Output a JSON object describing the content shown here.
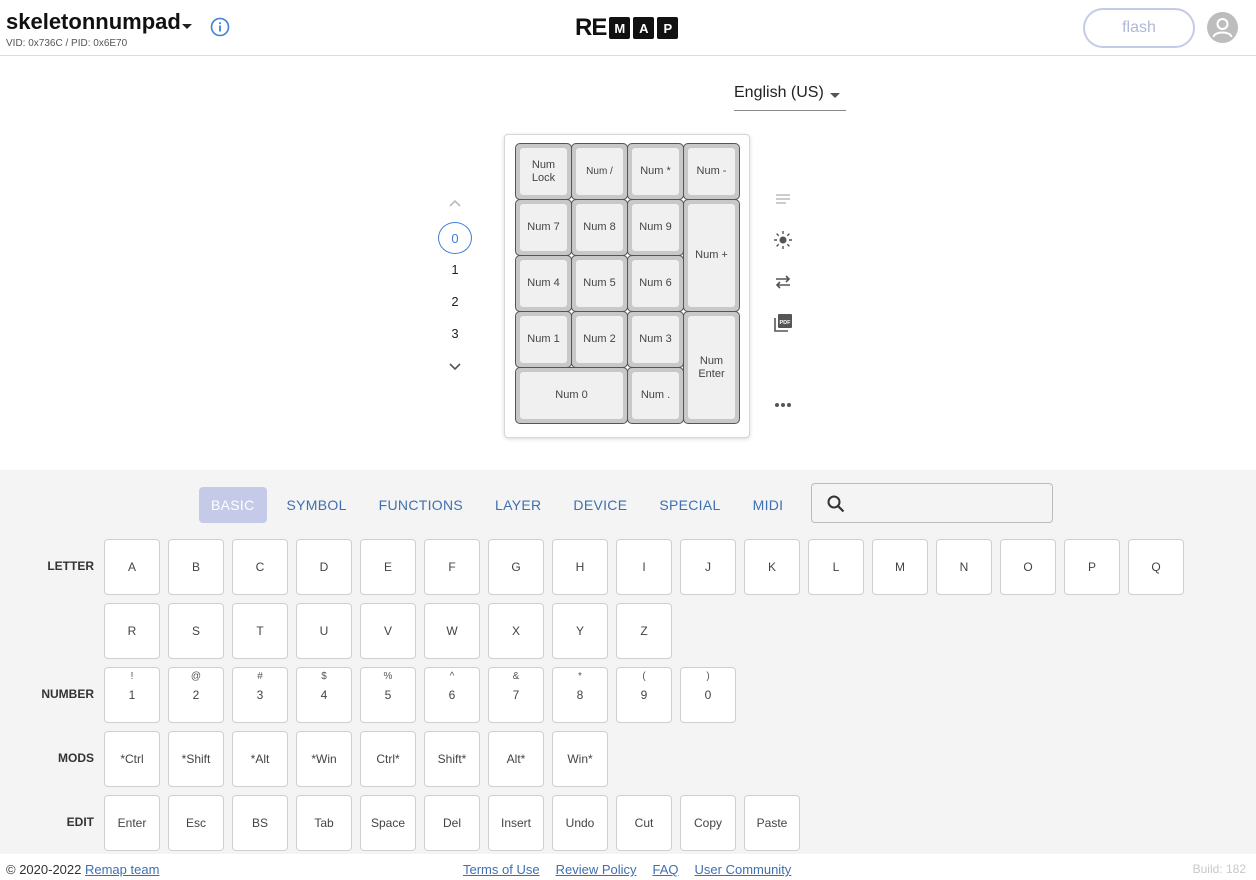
{
  "header": {
    "keyboard_name": "skeletonnumpad",
    "ids": "VID: 0x736C / PID: 0x6E70",
    "logo": {
      "plain": "RE",
      "boxed": [
        "M",
        "A",
        "P"
      ]
    },
    "flash_label": "flash"
  },
  "language": {
    "selected": "English (US)"
  },
  "layers": [
    "0",
    "1",
    "2",
    "3"
  ],
  "active_layer": "0",
  "keymap": [
    {
      "label": "Num\nLock"
    },
    {
      "label": "Num /"
    },
    {
      "label": "Num *"
    },
    {
      "label": "Num -"
    },
    {
      "label": "Num 7"
    },
    {
      "label": "Num 8"
    },
    {
      "label": "Num 9"
    },
    {
      "label": "Num +"
    },
    {
      "label": "Num 4"
    },
    {
      "label": "Num 5"
    },
    {
      "label": "Num 6"
    },
    {
      "label": "Num 1"
    },
    {
      "label": "Num 2"
    },
    {
      "label": "Num 3"
    },
    {
      "label": "Num\nEnter"
    },
    {
      "label": "Num 0"
    },
    {
      "label": "Num ."
    }
  ],
  "tabs": [
    "BASIC",
    "SYMBOL",
    "FUNCTIONS",
    "LAYER",
    "DEVICE",
    "SPECIAL",
    "MIDI"
  ],
  "active_tab": "BASIC",
  "search": {
    "placeholder": "",
    "value": ""
  },
  "keycode_groups": {
    "letter": {
      "label": "LETTER",
      "keys": [
        "A",
        "B",
        "C",
        "D",
        "E",
        "F",
        "G",
        "H",
        "I",
        "J",
        "K",
        "L",
        "M",
        "N",
        "O",
        "P",
        "Q",
        "R",
        "S",
        "T",
        "U",
        "V",
        "W",
        "X",
        "Y",
        "Z"
      ]
    },
    "number": {
      "label": "NUMBER",
      "keys": [
        {
          "shift": "!",
          "main": "1"
        },
        {
          "shift": "@",
          "main": "2"
        },
        {
          "shift": "#",
          "main": "3"
        },
        {
          "shift": "$",
          "main": "4"
        },
        {
          "shift": "%",
          "main": "5"
        },
        {
          "shift": "^",
          "main": "6"
        },
        {
          "shift": "&",
          "main": "7"
        },
        {
          "shift": "*",
          "main": "8"
        },
        {
          "shift": "(",
          "main": "9"
        },
        {
          "shift": ")",
          "main": "0"
        }
      ]
    },
    "mods": {
      "label": "MODS",
      "keys": [
        "*Ctrl",
        "*Shift",
        "*Alt",
        "*Win",
        "Ctrl*",
        "Shift*",
        "Alt*",
        "Win*"
      ]
    },
    "edit": {
      "label": "EDIT",
      "keys": [
        "Enter",
        "Esc",
        "BS",
        "Tab",
        "Space",
        "Del",
        "Insert",
        "Undo",
        "Cut",
        "Copy",
        "Paste"
      ]
    }
  },
  "footer": {
    "copyright": "© 2020-2022 ",
    "team_link": "Remap team",
    "links": [
      "Terms of Use",
      "Review Policy",
      "FAQ",
      "User Community"
    ],
    "build": "Build: 182"
  },
  "icons": {
    "info": "info-icon",
    "avatar": "account-icon",
    "search": "search-icon",
    "side": [
      "lines-icon",
      "brightness-icon",
      "swap-icon",
      "pdf-icon",
      "more-icon"
    ],
    "layer_up": "chevron-up-icon",
    "layer_down": "chevron-down-icon"
  },
  "colors": {
    "accent": "#3f7fd8",
    "tab_active_bg": "#c5cae9",
    "link": "#3f6fb0"
  }
}
